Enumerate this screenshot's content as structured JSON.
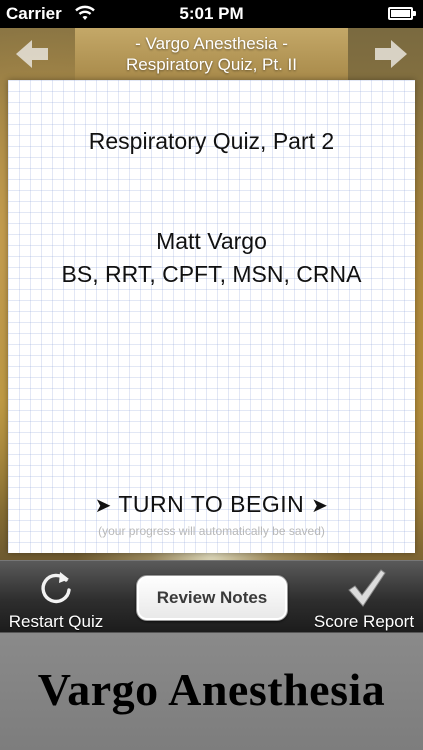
{
  "status_bar": {
    "carrier": "Carrier",
    "time": "5:01 PM"
  },
  "header": {
    "title_line1": "- Vargo Anesthesia -",
    "title_line2": "Respiratory Quiz, Pt. II",
    "left_icon": "arrow-left-icon",
    "right_icon": "arrow-right-icon"
  },
  "card": {
    "quiz_title": "Respiratory Quiz, Part 2",
    "author_name": "Matt Vargo",
    "author_credentials": "BS, RRT, CPFT, MSN, CRNA",
    "turn_arrow": "➤",
    "turn_label": "TURN TO BEGIN",
    "progress_note": "(your progress will automatically be saved)"
  },
  "toolbar": {
    "restart_label": "Restart Quiz",
    "restart_icon": "refresh-icon",
    "review_label": "Review Notes",
    "score_label": "Score Report",
    "score_icon": "checkmark-icon"
  },
  "brand": {
    "name": "Vargo Anesthesia"
  }
}
